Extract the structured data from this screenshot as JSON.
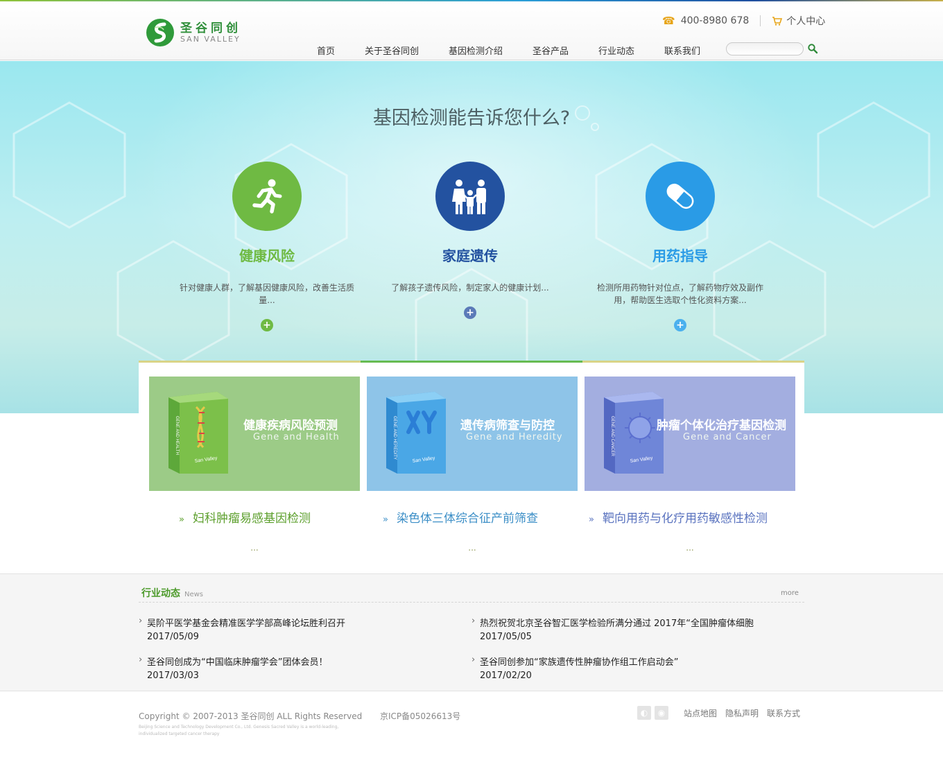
{
  "header": {
    "logo_cn": "圣谷同创",
    "logo_en": "SAN VALLEY",
    "phone": "400-8980 678",
    "account": "个人中心",
    "nav": [
      "首页",
      "关于圣谷同创",
      "基因检测介绍",
      "圣谷产品",
      "行业动态",
      "联系我们"
    ],
    "search_placeholder": ""
  },
  "hero": {
    "title": "基因检测能告诉您什么?",
    "features": [
      {
        "title": "健康风险",
        "desc": "针对健康人群，了解基因健康风险，改善生活质量...",
        "color": "#6fba43",
        "icon": "running-person-icon"
      },
      {
        "title": "家庭遗传",
        "desc": "了解孩子遗传风险，制定家人的健康计划...",
        "color": "#2352a0",
        "icon": "family-icon"
      },
      {
        "title": "用药指导",
        "desc": "检测所用药物针对位点，了解药物疗效及副作用，帮助医生选取个性化资料方案...",
        "color": "#2a9be6",
        "icon": "pill-icon"
      }
    ]
  },
  "products": [
    {
      "title": "健康疾病风险预测",
      "subtitle": "Gene and Health",
      "box_label": "GENE AND HEALTH",
      "box_brand": "San Valley",
      "link": "妇科肿瘤易感基因检测",
      "more": "...",
      "bg": "#9ccb87",
      "accent": "#d6cf7a",
      "link_color": "#5c9f2c"
    },
    {
      "title": "遗传病筛查与防控",
      "subtitle": "Gene and Heredity",
      "box_label": "GENE AND HEREDITY",
      "box_brand": "San Valley",
      "link": "染色体三体综合征产前筛查",
      "more": "...",
      "bg": "#8ec4e8",
      "accent": "#6dbd55",
      "link_color": "#3d8fc7"
    },
    {
      "title": "肿瘤个体化治疗基因检测",
      "subtitle": "Gene and Cancer",
      "box_label": "GENE AND CANCER",
      "box_brand": "San Valley",
      "link": "靶向用药与化疗用药敏感性检测",
      "more": "...",
      "bg": "#a3aee0",
      "accent": "#d6cf7a",
      "link_color": "#5a73bf"
    }
  ],
  "news": {
    "title": "行业动态",
    "title_en": "News",
    "more": "more",
    "items": [
      {
        "title": "吴阶平医学基金会精准医学学部高峰论坛胜利召开",
        "date": "2017/05/09"
      },
      {
        "title": "热烈祝贺北京圣谷智汇医学检验所满分通过 2017年“全国肿瘤体细胞",
        "date": "2017/05/05"
      },
      {
        "title": "圣谷同创成为“中国临床肿瘤学会”团体会员！",
        "date": "2017/03/03"
      },
      {
        "title": "圣谷同创参加“家族遗传性肿瘤协作组工作启动会”",
        "date": "2017/02/20"
      }
    ]
  },
  "footer": {
    "copyright": "Copyright © 2007-2013 圣谷同创 ALL Rights Reserved",
    "icp": "京ICP备05026613号",
    "tiny": "Beijing Science and Technology Development Co., Ltd. Genesis Sacred Valley is a world-leading, individualized targeted cancer therapy",
    "links": [
      "站点地图",
      "隐私声明",
      "联系方式"
    ]
  }
}
